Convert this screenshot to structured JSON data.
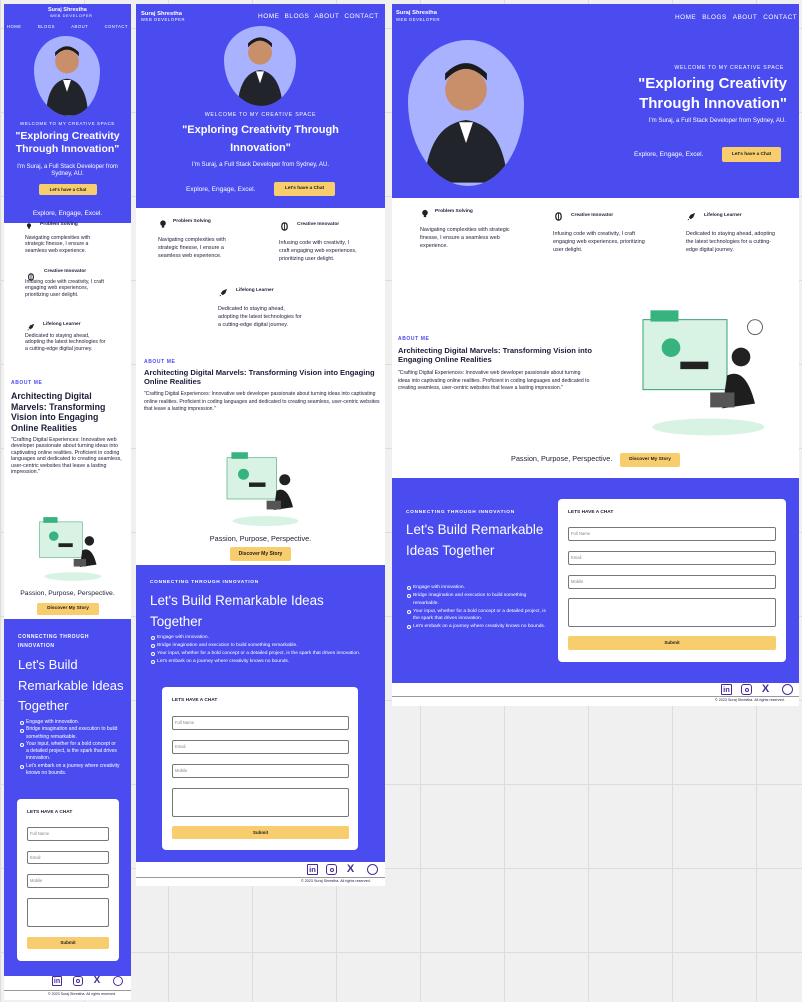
{
  "site": {
    "name": "Suraj Shrestha",
    "role": "WEB DEVELOPER",
    "nav": [
      "HOME",
      "BLOGS",
      "ABOUT",
      "CONTACT"
    ]
  },
  "hero": {
    "welcome": "WELCOME TO MY CREATIVE SPACE",
    "headline": "\"Exploring Creativity Through Innovation\"",
    "intro": "I'm Suraj, a Full Stack Developer from Sydney, AU.",
    "cta": "Let's have a Chat",
    "tagline": "Explore, Engage, Excel."
  },
  "features": [
    {
      "icon": "lightbulb-icon",
      "title": "Problem Solving",
      "text": "Navigating complexities with strategic finesse, I ensure a seamless web experience."
    },
    {
      "icon": "brain-icon",
      "title": "Creative Innovator",
      "text": "Infusing code with creativity, I craft engaging web experiences, prioritizing user delight."
    },
    {
      "icon": "rocket-icon",
      "title": "Lifelong Learner",
      "text": "Dedicated to staying ahead, adopting the latest technologies for a cutting-edge digital journey."
    }
  ],
  "about": {
    "eyebrow": "ABOUT ME",
    "title": "Architecting Digital Marvels: Transforming Vision into Engaging Online Realities",
    "text": "\"Crafting Digital Experiences: Innovative web developer passionate about turning ideas into captivating online realities. Proficient in coding languages and dedicated to creating seamless, user-centric websites that leave a lasting impression.\"",
    "tagline": "Passion, Purpose, Perspective.",
    "cta": "Discover My Story"
  },
  "contact": {
    "eyebrow": "CONNECTING THROUGH INNOVATION",
    "title": "Let's Build Remarkable Ideas Together",
    "bullets": [
      "Engage with innovation.",
      "Bridge imagination and execution to build something remarkable.",
      "Your input, whether for a bold concept or a detailed project, is the spark that drives innovation.",
      "Let's embark on a journey where creativity knows no bounds."
    ],
    "form_title": "LETS HAVE A CHAT",
    "full_name_placeholder": "Full Name",
    "email_placeholder": "Email",
    "mobile_placeholder": "Mobile",
    "submit": "Submit"
  },
  "footer": {
    "socials": [
      "linkedin-icon",
      "instagram-icon",
      "x-icon",
      "github-icon"
    ],
    "copyright": "© 2023 Suraj Shrestha. All rights reserved."
  },
  "colors": {
    "brand": "#4a4cf0",
    "accent": "#f8cd6e",
    "avatar_blob": "#a9b2ff",
    "illustration": "#36b37e"
  }
}
